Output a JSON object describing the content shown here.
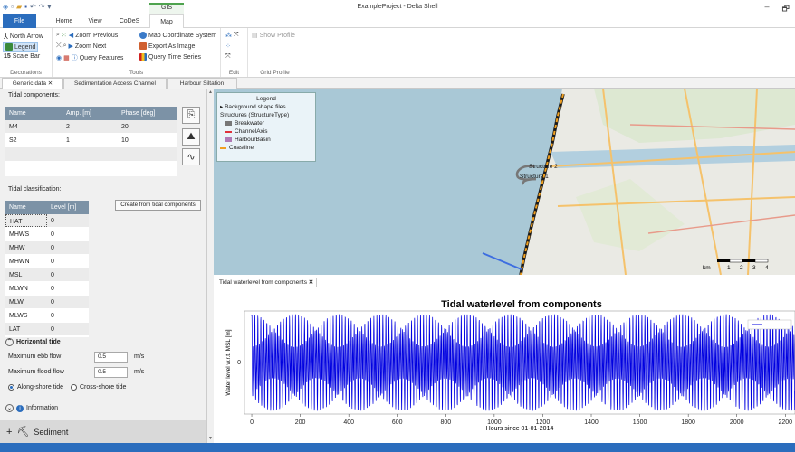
{
  "window": {
    "title": "ExampleProject - Delta Shell",
    "minimize": "–",
    "restore": "🗗"
  },
  "tabs": {
    "file": "File",
    "home": "Home",
    "view": "View",
    "codes": "CoDeS",
    "map": "Map",
    "contextual": "GIS"
  },
  "ribbon": {
    "decorations": {
      "label": "Decorations",
      "north_arrow": "North Arrow",
      "legend": "Legend",
      "scale_bar": "Scale Bar"
    },
    "tools": {
      "label": "Tools",
      "zoom_previous": "Zoom Previous",
      "zoom_next": "Zoom Next",
      "query_features": "Query Features",
      "map_coordinate_system": "Map Coordinate System",
      "export_as_image": "Export As Image",
      "query_time_series": "Query Time Series"
    },
    "edit": {
      "label": "Edit"
    },
    "grid_profile": {
      "label": "Grid Profile",
      "show_profile": "Show Profile"
    }
  },
  "doc_tabs": [
    "Generic data",
    "Sedimentation Access Channel",
    "Harbour Siltation"
  ],
  "doc_tab_close": "✕",
  "generic": {
    "tidal_components_label": "Tidal components:",
    "tidal_headers": [
      "Name",
      "Amp. [m]",
      "Phase [deg]"
    ],
    "tidal_rows": [
      [
        "M4",
        "2",
        "20"
      ],
      [
        "S2",
        "1",
        "10"
      ]
    ],
    "tidal_classification_label": "Tidal classification:",
    "create_button": "Create from tidal components",
    "class_headers": [
      "Name",
      "Level [m]"
    ],
    "class_rows": [
      [
        "HAT",
        "0"
      ],
      [
        "MHWS",
        "0"
      ],
      [
        "MHW",
        "0"
      ],
      [
        "MHWN",
        "0"
      ],
      [
        "MSL",
        "0"
      ],
      [
        "MLWN",
        "0"
      ],
      [
        "MLW",
        "0"
      ],
      [
        "MLWS",
        "0"
      ],
      [
        "LAT",
        "0"
      ]
    ],
    "horizontal_tide": "Horizontal tide",
    "max_ebb_label": "Maximum ebb flow",
    "max_ebb_value": "0.5",
    "max_ebb_unit": "m/s",
    "max_flood_label": "Maximum flood flow",
    "max_flood_value": "0.5",
    "max_flood_unit": "m/s",
    "along_shore": "Along-shore tide",
    "cross_shore": "Cross-shore tide",
    "information": "Information",
    "sediment": "Sediment"
  },
  "map": {
    "legend": {
      "title": "Legend",
      "background": "Background shape files",
      "structures": "Structures (StructureType)",
      "items": [
        "Breakwater",
        "ChannelAxis",
        "HarbourBasin",
        "Coastline"
      ],
      "colors": [
        "#777777",
        "#e0303a",
        "#b07ab5",
        "#f0a020"
      ]
    },
    "labels": {
      "structure2": "Structure 2",
      "structure1": "Structure 1"
    },
    "scale": {
      "unit": "km",
      "ticks": [
        "1",
        "2",
        "3",
        "4"
      ]
    }
  },
  "chart_tab": {
    "label": "Tidal waterlevel from components",
    "close": "✕"
  },
  "chart_data": {
    "type": "line",
    "title": "Tidal waterlevel from components",
    "xlabel": "Hours since 01-01-2014",
    "ylabel": "Water level w.r.t. MSL [m]",
    "xlim": [
      -30,
      2240
    ],
    "ylim": [
      -3.2,
      3.2
    ],
    "xticks": [
      0,
      200,
      400,
      600,
      800,
      1000,
      1200,
      1400,
      1600,
      1800,
      2000,
      2200
    ],
    "yticks": [
      0
    ],
    "series": [
      {
        "components": [
          {
            "name": "M4",
            "amplitude": 2,
            "phase_deg": 20,
            "period_h": 6.21
          },
          {
            "name": "S2",
            "amplitude": 1,
            "phase_deg": 10,
            "period_h": 12.0
          }
        ],
        "color": "#0000e0"
      }
    ],
    "legend_position": "top-right"
  }
}
